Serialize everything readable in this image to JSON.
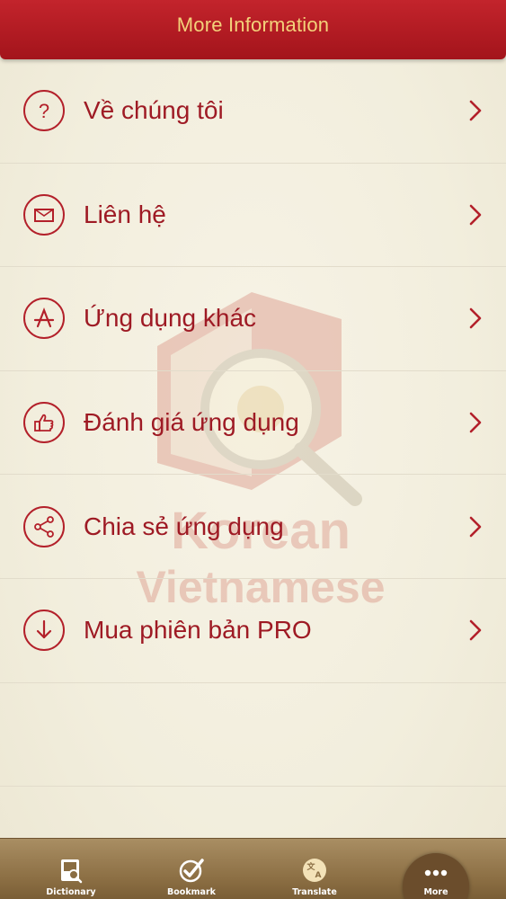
{
  "header": {
    "title": "More Information"
  },
  "watermark": {
    "line1": "Korean",
    "line2": "Vietnamese"
  },
  "menu": {
    "items": [
      {
        "label": "Về chúng tôi",
        "icon": "question-icon"
      },
      {
        "label": "Liên hệ",
        "icon": "mail-icon"
      },
      {
        "label": "Ứng dụng khác",
        "icon": "app-store-icon"
      },
      {
        "label": "Đánh giá ứng dụng",
        "icon": "thumbs-up-icon"
      },
      {
        "label": "Chia sẻ ứng dụng",
        "icon": "share-icon"
      },
      {
        "label": "Mua phiên bản PRO",
        "icon": "download-icon"
      }
    ]
  },
  "tabbar": {
    "tabs": [
      {
        "label": "Dictionary",
        "icon": "dictionary-icon"
      },
      {
        "label": "Bookmark",
        "icon": "bookmark-check-icon"
      },
      {
        "label": "Translate",
        "icon": "translate-icon"
      },
      {
        "label": "More",
        "icon": "more-dots-icon",
        "active": true
      }
    ]
  },
  "colors": {
    "header_bg": "#b01c24",
    "header_text": "#f3d27a",
    "accent": "#9e1a24",
    "background": "#f4f0e2",
    "tabbar_bg": "#8f7248"
  }
}
